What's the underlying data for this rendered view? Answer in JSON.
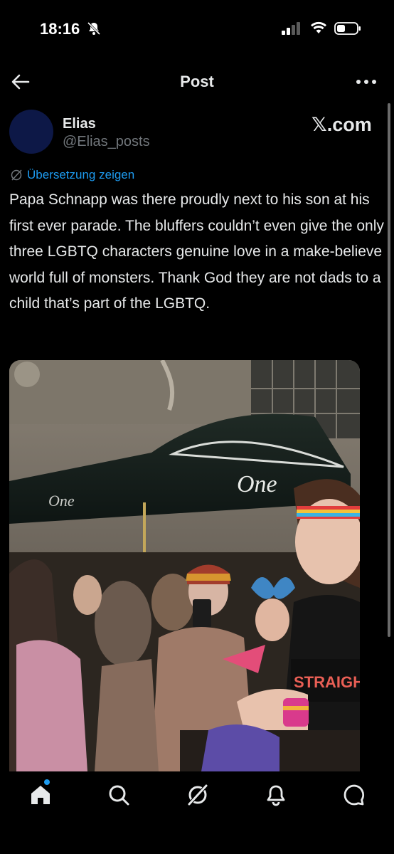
{
  "status_bar": {
    "time": "18:16"
  },
  "header": {
    "title": "Post"
  },
  "author": {
    "name": "Elias",
    "handle": "@Elias_posts"
  },
  "watermark": "𝕏.com",
  "translate_label": "Übersetzung zeigen",
  "post": {
    "text": "Papa Schnapp was there proudly next to his son at his first ever parade. The bluffers couldn’t even give the only three LGBTQ characters genuine love in a make-believe world full of monsters. Thank God they are not dads to a child that’s part of the LGBTQ."
  },
  "media": {
    "awning_text_large": "One",
    "awning_text_small": "One",
    "shirt_text": "STRAIGHT"
  },
  "bottom_nav": {
    "items": [
      "home-icon",
      "search-icon",
      "grok-icon",
      "notifications-icon",
      "messages-icon"
    ]
  },
  "colors": {
    "accent": "#1d9bf0",
    "background": "#000000",
    "text": "#e7e9ea",
    "secondary": "#71767b"
  }
}
